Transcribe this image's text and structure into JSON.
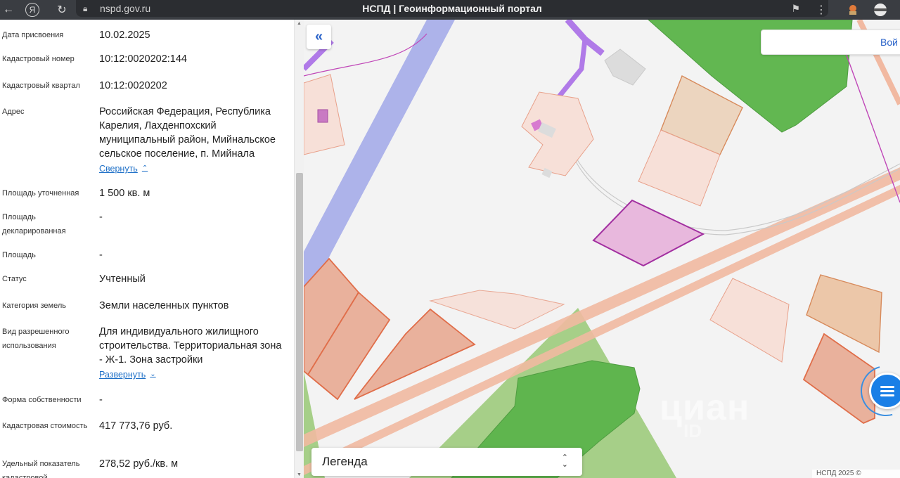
{
  "browser": {
    "url": "nspd.gov.ru",
    "page_title": "НСПД | Геоинформационный портал",
    "back_icon": "arrow-left-icon",
    "yandex_icon": "yandex-logo-icon",
    "reload_icon": "reload-icon"
  },
  "panel": {
    "rows": [
      {
        "label": "Дата присвоения",
        "value": "10.02.2025"
      },
      {
        "label": "Кадастровый номер",
        "value": "10:12:0020202:144"
      },
      {
        "label": "Кадастровый квартал",
        "value": "10:12:0020202"
      },
      {
        "label": "Адрес",
        "value": "Российская Федерация, Республика Карелия, Лахденпохский муниципальный район, Мийнальское сельское поселение, п. Мийнала",
        "toggle": "Свернуть"
      },
      {
        "label": "Площадь уточненная",
        "value": "1 500 кв. м"
      },
      {
        "label": "Площадь декларированная",
        "value": "-"
      },
      {
        "label": "Площадь",
        "value": "-"
      },
      {
        "label": "Статус",
        "value": "Учтенный"
      },
      {
        "label": "Категория земель",
        "value": "Земли населенных пунктов"
      },
      {
        "label": "Вид разрешенного использования",
        "value": "Для индивидуального жилищного строительства. Территориальная зона - Ж-1. Зона застройки",
        "toggle": "Развернуть"
      },
      {
        "label": "Форма собственности",
        "value": "-"
      },
      {
        "label": "Кадастровая стоимость",
        "value": "417 773,76 руб."
      },
      {
        "label": "Удельный показатель кадастровой",
        "value": "278,52 руб./кв. м"
      }
    ]
  },
  "map": {
    "search_button": "Вой",
    "legend_label": "Легенда",
    "watermark": "циан",
    "watermark_sub": "ID",
    "copyright": "НСПД 2025 ©"
  },
  "colors": {
    "selected_parcel": "#e8b8dd",
    "selected_outline": "#a22fa0",
    "parcel_fill": "#f6dcd4",
    "forest": "#5fb54e",
    "road": "#f1b9a1",
    "water": "#a9b0e8",
    "accent": "#1a7fe6"
  }
}
